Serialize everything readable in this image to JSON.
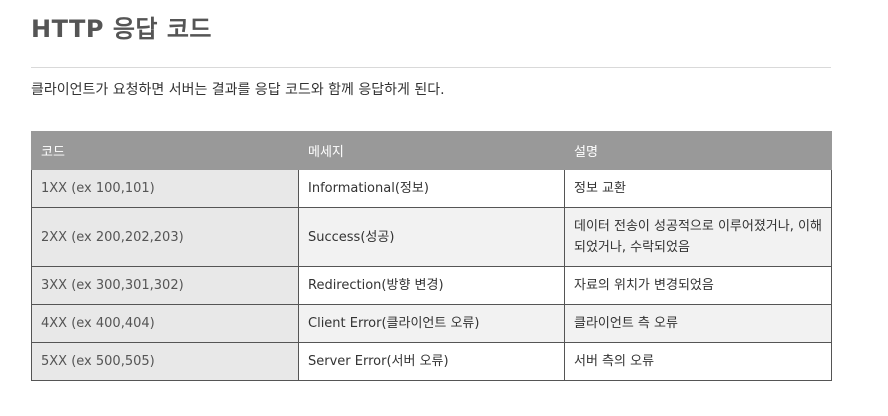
{
  "title": "HTTP 응답 코드",
  "intro": "클라이언트가 요청하면 서버는 결과를 응답 코드와 함께 응답하게 된다.",
  "table": {
    "headers": [
      "코드",
      "메세지",
      "설명"
    ],
    "rows": [
      [
        "1XX (ex 100,101)",
        "Informational(정보)",
        "정보 교환"
      ],
      [
        "2XX (ex 200,202,203)",
        "Success(성공)",
        "데이터 전송이 성공적으로 이루어졌거나, 이해되었거나, 수락되었음"
      ],
      [
        "3XX (ex 300,301,302)",
        "Redirection(방향 변경)",
        "자료의 위치가 변경되었음"
      ],
      [
        "4XX (ex 400,404)",
        "Client Error(클라이언트 오류)",
        "클라이언트 측 오류"
      ],
      [
        "5XX (ex 500,505)",
        "Server Error(서버 오류)",
        "서버 측의 오류"
      ]
    ]
  },
  "colors": {
    "header_bg": "#999999",
    "code_cell_bg": "#e8e8e8",
    "alt_row_bg": "#f2f2f2"
  }
}
